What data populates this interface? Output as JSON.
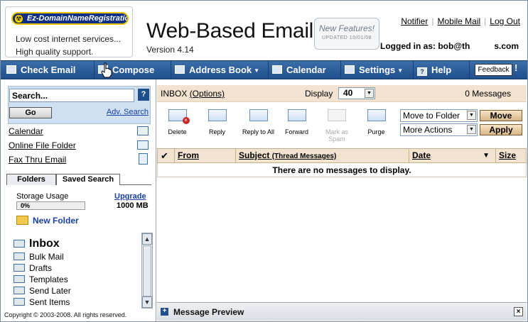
{
  "header": {
    "logo": "Ez-DomainNameRegistration",
    "tagline1": "Low cost internet services...",
    "tagline2": "High quality support.",
    "app_title": "Web-Based Email",
    "version": "Version 4.14",
    "new_features": "New Features!",
    "new_features_updated": "UPDATED 10/01/08",
    "links": [
      "Notifier",
      "Mobile Mail",
      "Log Out"
    ],
    "logged_in_prefix": "Logged in as: bob@th",
    "logged_in_suffix": "s.com"
  },
  "toolbar": {
    "check_email": "Check Email",
    "compose": "Compose",
    "address_book": "Address Book",
    "calendar": "Calendar",
    "settings": "Settings",
    "help": "Help",
    "feedback": "Feedback",
    "feedback_mark": "!"
  },
  "sidebar": {
    "search_value": "Search...",
    "go": "Go",
    "adv_search": "Adv. Search",
    "links": [
      "Calendar",
      "Online File Folder",
      "Fax Thru Email"
    ],
    "tabs": [
      "Folders",
      "Saved Search"
    ],
    "storage_label": "Storage Usage",
    "storage_used": "0%",
    "storage_total": "1000 MB",
    "upgrade": "Upgrade",
    "new_folder": "New Folder",
    "folders": [
      "Inbox",
      "Bulk Mail",
      "Drafts",
      "Templates",
      "Send Later",
      "Sent Items"
    ],
    "copyright": "Copyright © 2003-2008. All rights reserved."
  },
  "main": {
    "folder_name": "INBOX",
    "options": "(Options)",
    "display_label": "Display",
    "display_value": "40",
    "message_count": "0 Messages",
    "actions": [
      "Delete",
      "Reply",
      "Reply to All",
      "Forward",
      "Mark as Spam",
      "Purge"
    ],
    "move_to_folder": "Move to Folder",
    "move": "Move",
    "more_actions": "More Actions",
    "apply": "Apply",
    "columns": {
      "from": "From",
      "subject": "Subject",
      "thread": "(Thread Messages)",
      "date": "Date",
      "size": "Size"
    },
    "empty_message": "There are no messages to display.",
    "preview": "Message Preview"
  },
  "colors": {
    "toolbar": "#2a5b97",
    "header_band": "#f1e3cf",
    "link_blue": "#1840a0"
  }
}
